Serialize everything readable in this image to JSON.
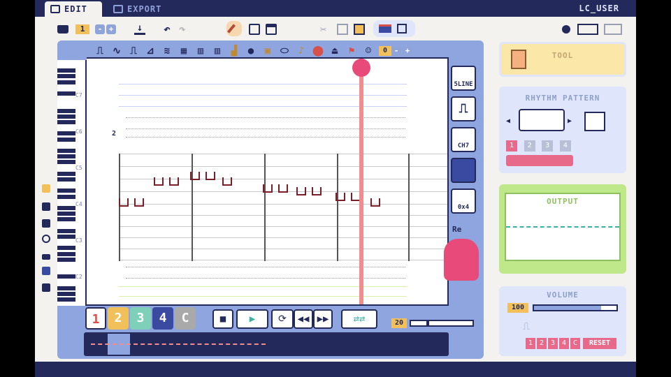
{
  "header": {
    "tabs": [
      {
        "label": "EDIT"
      },
      {
        "label": "EXPORT"
      }
    ],
    "user": "LC_USER"
  },
  "toolbar": {
    "page_number": "1",
    "minus": "-",
    "plus": "+"
  },
  "editor": {
    "octave_labels": [
      "C7",
      "C6",
      "C5",
      "C4",
      "C3",
      "C2"
    ],
    "instrument_counter": "0",
    "measure_number": "2",
    "side_buttons": {
      "lines": "5LINE",
      "chords": "CH7",
      "grid": "0x4"
    },
    "re_label": "Re",
    "tracks": [
      "1",
      "2",
      "3",
      "4",
      "C"
    ],
    "tempo": "20",
    "colors": {
      "track1": "#ffffff",
      "track2": "#f1c05a",
      "track3": "#7fd0b8",
      "track4": "#3a4aa0",
      "trackC": "#a9a9a9",
      "playhead": "#f28d8d",
      "note": "#7a1f2a"
    }
  },
  "tool": {
    "title": "TOOL"
  },
  "rhythm": {
    "title": "RHYTHM PATTERN",
    "digits": [
      "1",
      "2",
      "3",
      "4"
    ]
  },
  "output": {
    "title": "OUTPUT"
  },
  "volume": {
    "title": "VOLUME",
    "value": "100",
    "tracks": [
      "1",
      "2",
      "3",
      "4",
      "C"
    ],
    "reset": "RESET"
  }
}
